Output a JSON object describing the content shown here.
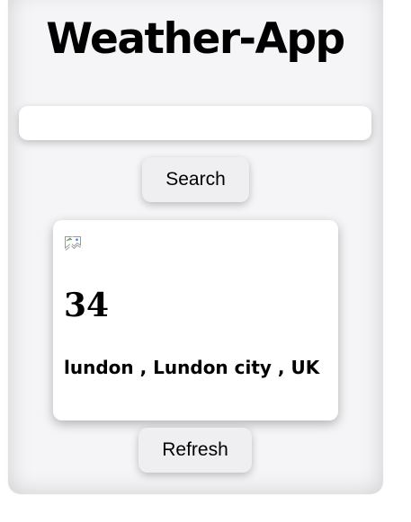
{
  "app": {
    "title": "Weather-App"
  },
  "search": {
    "value": "",
    "placeholder": "",
    "button_label": "Search"
  },
  "weather": {
    "icon": "broken-image-icon",
    "temperature": "34",
    "location": "lundon , Lundon city , UK"
  },
  "refresh": {
    "button_label": "Refresh"
  }
}
